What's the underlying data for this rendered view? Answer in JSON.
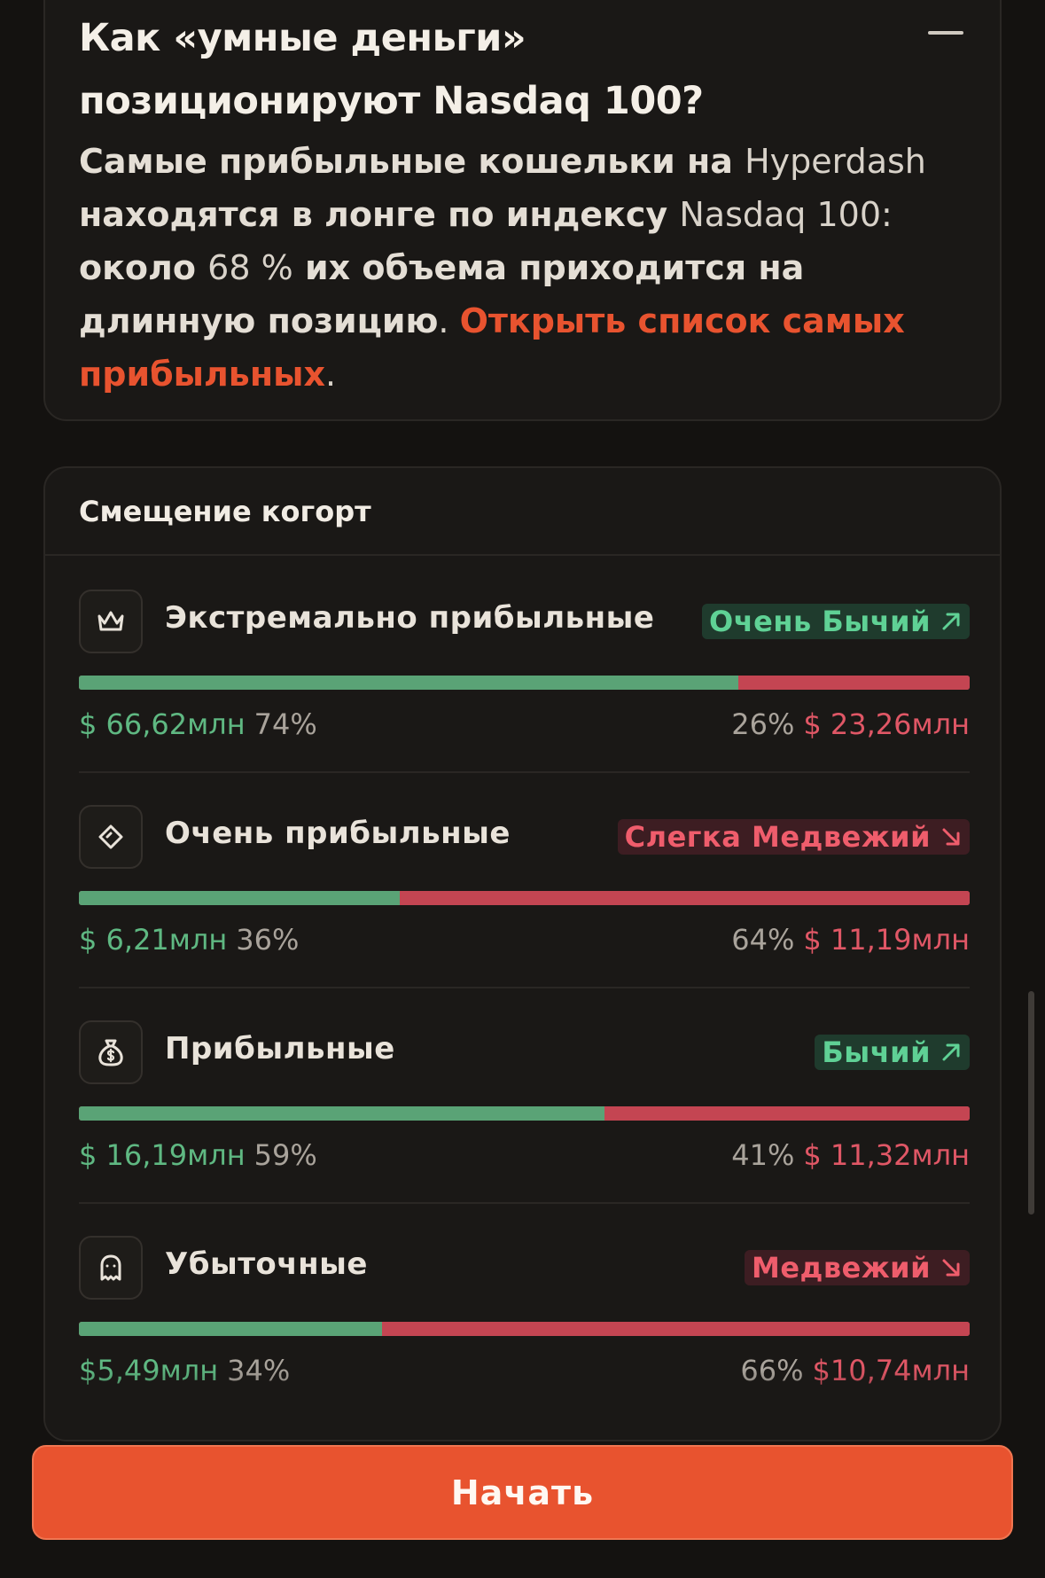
{
  "faq": {
    "question": "Как «умные деньги» позиционируют Nasdaq 100?",
    "answer_part1": "Самые прибыльные кошельки на ",
    "answer_brand": "Hyperdash",
    "answer_part2": " находятся в лонге по индексу ",
    "answer_index": "Nasdaq 100:",
    "answer_part3": " около ",
    "answer_pct": "68 %",
    "answer_part4": " их объема приходится на длинную позицию",
    "answer_dot1": ". ",
    "answer_link": "Открыть список самых прибыльных",
    "answer_dot2": "."
  },
  "cohorts": {
    "title": "Смещение когорт",
    "rows": [
      {
        "name": "Экстремально прибыльные",
        "icon": "crown-icon",
        "sentiment": "Очень Бычий",
        "sentiment_type": "bull",
        "long_fraction": 0.74,
        "long_amount": "$ 66,62млн",
        "long_pct": "74%",
        "short_pct": "26%",
        "short_amount": "$ 23,26млн"
      },
      {
        "name": "Очень прибыльные",
        "icon": "diamond-icon",
        "sentiment": "Слегка Медвежий",
        "sentiment_type": "bear",
        "long_fraction": 0.36,
        "long_amount": "$ 6,21млн",
        "long_pct": "36%",
        "short_pct": "64%",
        "short_amount": "$ 11,19млн"
      },
      {
        "name": "Прибыльные",
        "icon": "money-bag-icon",
        "sentiment": "Бычий",
        "sentiment_type": "bull",
        "long_fraction": 0.59,
        "long_amount": "$ 16,19млн",
        "long_pct": "59%",
        "short_pct": "41%",
        "short_amount": "$ 11,32млн"
      },
      {
        "name": "Убыточные",
        "icon": "ghost-icon",
        "sentiment": "Медвежий",
        "sentiment_type": "bear",
        "long_fraction": 0.34,
        "long_amount": "$5,49млн",
        "long_pct": "34%",
        "short_pct": "66%",
        "short_amount": "$10,74млн"
      }
    ]
  },
  "start_button": {
    "label": "Начать"
  },
  "colors": {
    "accent": "#e8532f",
    "bull": "#5fd195",
    "bear": "#ef5d6c",
    "long_bar": "#5aa376",
    "short_bar": "#c44552"
  }
}
